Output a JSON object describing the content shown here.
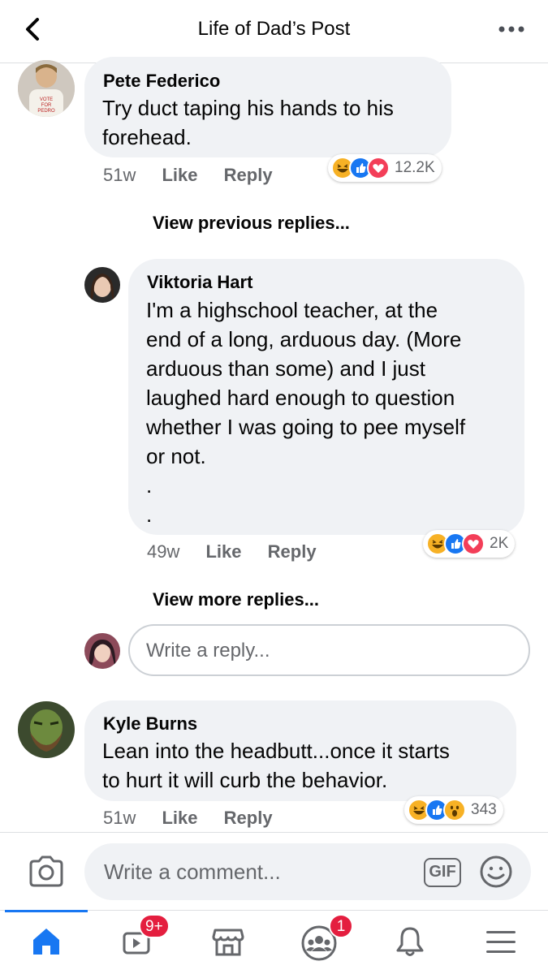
{
  "header": {
    "title": "Life of Dad’s Post"
  },
  "comments": [
    {
      "name": "Pete Federico",
      "text": "Try duct taping his hands to his\nforehead.",
      "time": "51w",
      "like": "Like",
      "reply": "Reply",
      "reactions": [
        "haha",
        "like",
        "love"
      ],
      "reaction_count": "12.2K"
    },
    {
      "name": "Viktoria Hart",
      "text": "I'm a highschool teacher, at the\nend of a long, arduous day. (More\narduous than some) and I just\nlaughed hard enough to question\nwhether I was going to pee myself\nor not.\n.\n.",
      "time": "49w",
      "like": "Like",
      "reply": "Reply",
      "reactions": [
        "haha",
        "like",
        "love"
      ],
      "reaction_count": "2K"
    },
    {
      "name": "Kyle Burns",
      "text": "Lean into the headbutt...once it starts\nto hurt it will curb the behavior.",
      "time": "51w",
      "like": "Like",
      "reply": "Reply",
      "reactions": [
        "haha",
        "like",
        "wow"
      ],
      "reaction_count": "343"
    }
  ],
  "links": {
    "view_previous": "View previous replies...",
    "view_more": "View more replies..."
  },
  "reply_box": {
    "placeholder": "Write a reply..."
  },
  "composer": {
    "placeholder": "Write a comment...",
    "gif_label": "GIF"
  },
  "tabbar": {
    "items": [
      "home-icon",
      "watch-icon",
      "marketplace-icon",
      "groups-icon",
      "notifications-icon",
      "menu-icon"
    ],
    "active": "home-icon",
    "watch_badge": "9+",
    "groups_badge": "1"
  },
  "colors": {
    "accent": "#1877f2",
    "bubble": "#f0f2f5",
    "secondary_text": "#65676b",
    "badge": "#e41e3f"
  }
}
